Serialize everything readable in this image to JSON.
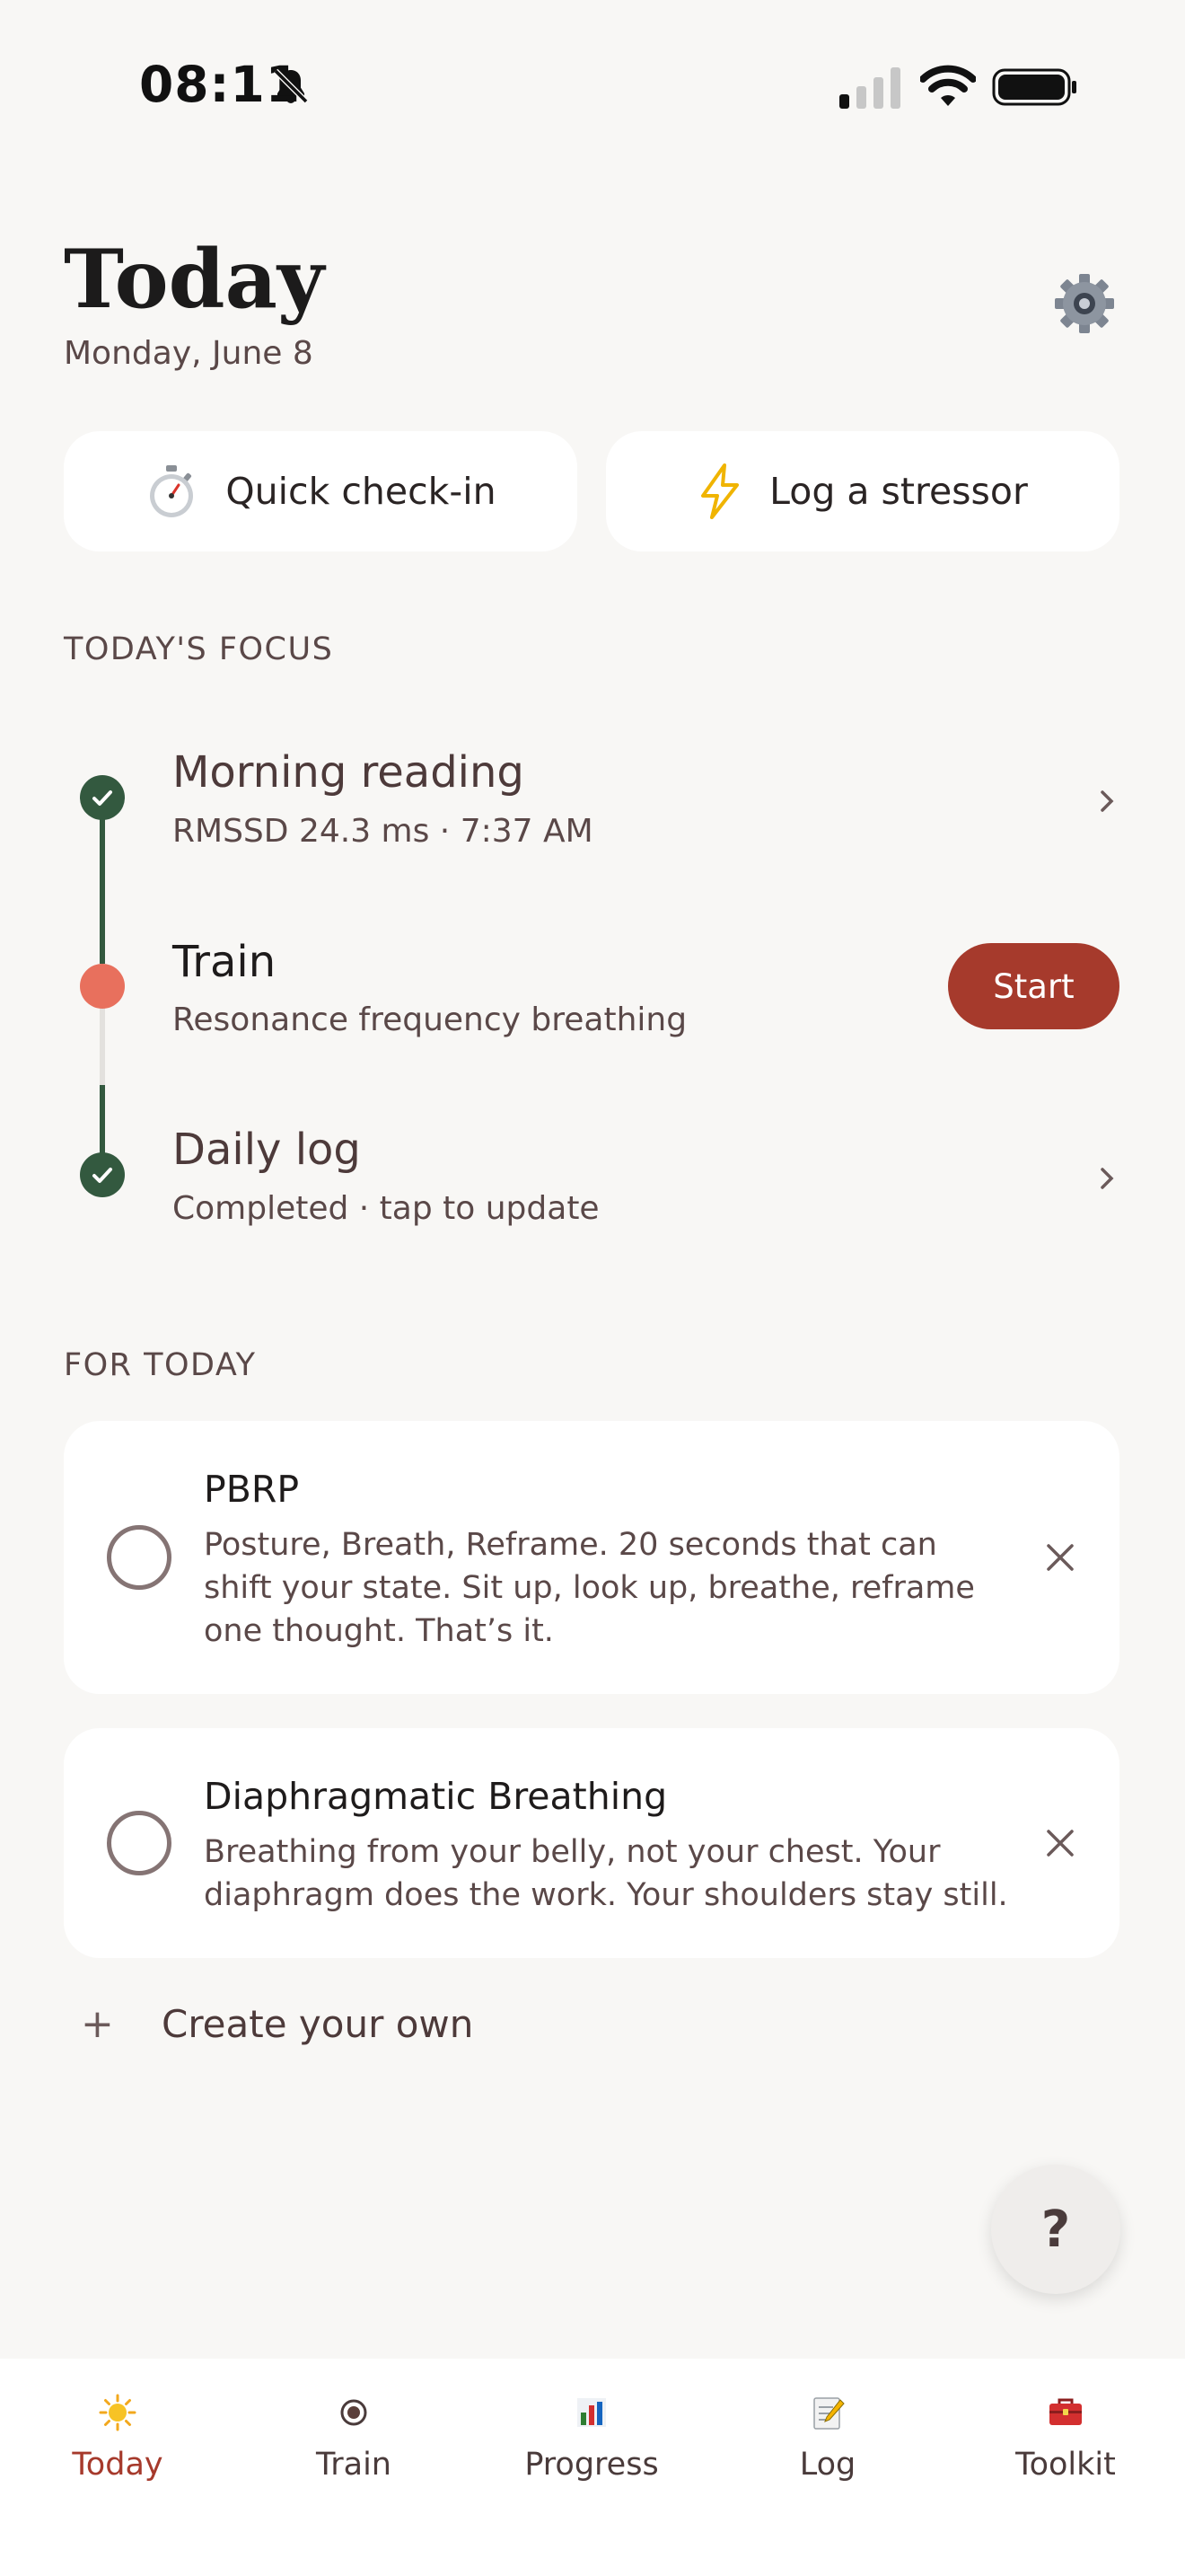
{
  "status_bar": {
    "time": "08:11"
  },
  "header": {
    "title": "Today",
    "date": "Monday, June 8"
  },
  "quick_actions": [
    {
      "label": "Quick check-in",
      "icon": "stopwatch-icon"
    },
    {
      "label": "Log a stressor",
      "icon": "lightning-icon"
    }
  ],
  "focus": {
    "section_title": "TODAY'S FOCUS",
    "items": [
      {
        "title": "Morning reading",
        "subtitle": "RMSSD 24.3 ms · 7:37 AM",
        "state": "done"
      },
      {
        "title": "Train",
        "subtitle": "Resonance frequency breathing",
        "state": "active",
        "action_label": "Start"
      },
      {
        "title": "Daily log",
        "subtitle": "Completed · tap to update",
        "state": "done"
      }
    ]
  },
  "for_today": {
    "section_title": "FOR TODAY",
    "cards": [
      {
        "title": "PBRP",
        "body": "Posture, Breath, Reframe. 20 seconds that can shift your state. Sit up, look up, breathe, reframe one thought. That’s it."
      },
      {
        "title": "Diaphragmatic Breathing",
        "body": "Breathing from your belly, not your chest. Your diaphragm does the work. Your shoulders stay still."
      }
    ],
    "create_label": "Create your own"
  },
  "help_label": "?",
  "tabs": [
    {
      "label": "Today",
      "icon": "sun-icon",
      "active": true
    },
    {
      "label": "Train",
      "icon": "target-icon",
      "active": false
    },
    {
      "label": "Progress",
      "icon": "chart-icon",
      "active": false
    },
    {
      "label": "Log",
      "icon": "memo-icon",
      "active": false
    },
    {
      "label": "Toolkit",
      "icon": "toolbox-icon",
      "active": false
    }
  ],
  "colors": {
    "accent": "#a63a2c",
    "done": "#33593f",
    "active_dot": "#e8705d",
    "background": "#f8f7f5"
  }
}
